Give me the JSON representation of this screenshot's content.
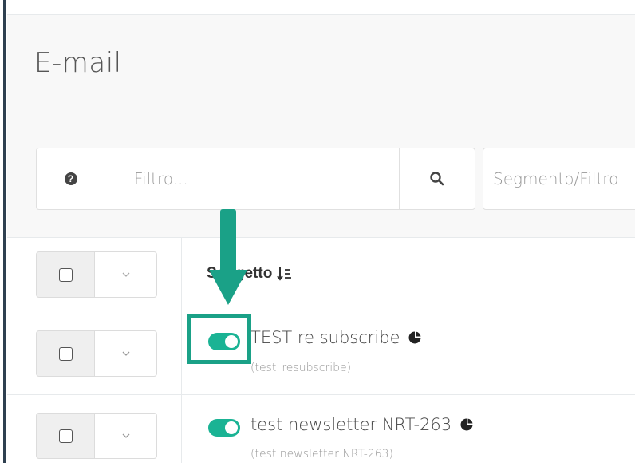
{
  "page": {
    "title": "E-mail"
  },
  "toolbar": {
    "filter_placeholder": "Filtro...",
    "segment_placeholder": "Segmento/Filtro",
    "help_icon": "question-circle-icon",
    "search_icon": "search-icon"
  },
  "table": {
    "column_header": "Soggetto",
    "sort_icon": "sort-desc-icon",
    "rows": [
      {
        "title": "TEST re subscribe",
        "subtitle": "(test_resubscribe)",
        "enabled": true
      },
      {
        "title": "test newsletter NRT-263",
        "subtitle": "(test newsletter NRT-263)",
        "enabled": true
      }
    ]
  },
  "colors": {
    "accent": "#1ab394",
    "annotation": "#1aa187",
    "sidebar": "#2f4050"
  }
}
